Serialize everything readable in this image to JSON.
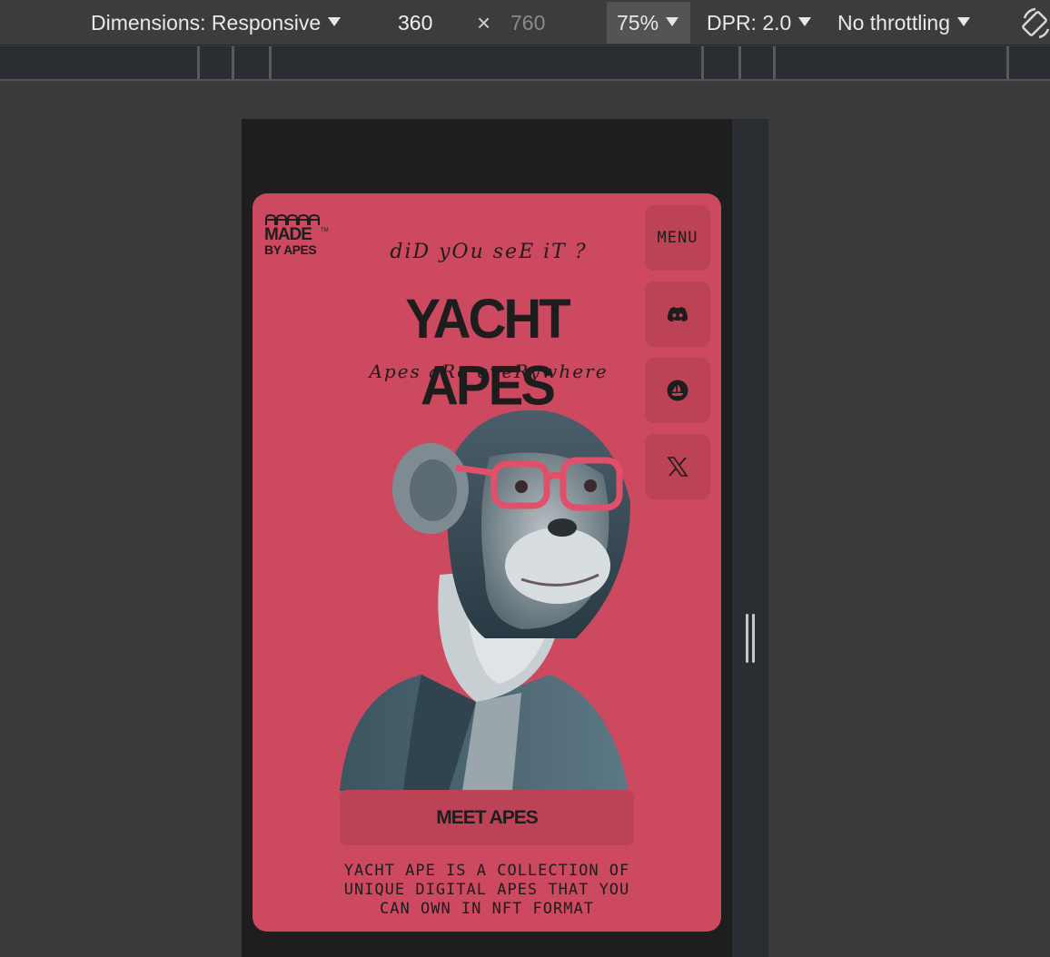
{
  "devtools": {
    "dimensions_label": "Dimensions: Responsive",
    "width_value": "360",
    "times_sign": "×",
    "height_value": "760",
    "zoom_value": "75%",
    "dpr_label": "DPR: 2.0",
    "throttling_label": "No throttling"
  },
  "site": {
    "logo_line1": "MADE",
    "logo_line2": "BY APES",
    "logo_tm": "TM",
    "tagline": "diD yOu seE iT ?",
    "title": "YACHT APES",
    "subtitle": "Apes aRe eveRywhere",
    "menu_label": "MENU",
    "social": [
      "discord-icon",
      "opensea-icon",
      "x-icon"
    ],
    "cta_label": "MEET APES",
    "description": "YACHT APE IS A COLLECTION OF UNIQUE DIGITAL APES THAT YOU CAN OWN IN NFT FORMAT"
  },
  "colors": {
    "card_bg": "#cc4960",
    "button_bg": "#bc4256",
    "text_dark": "#1d1d1d",
    "toolbar_bg": "#3c3c3c"
  }
}
